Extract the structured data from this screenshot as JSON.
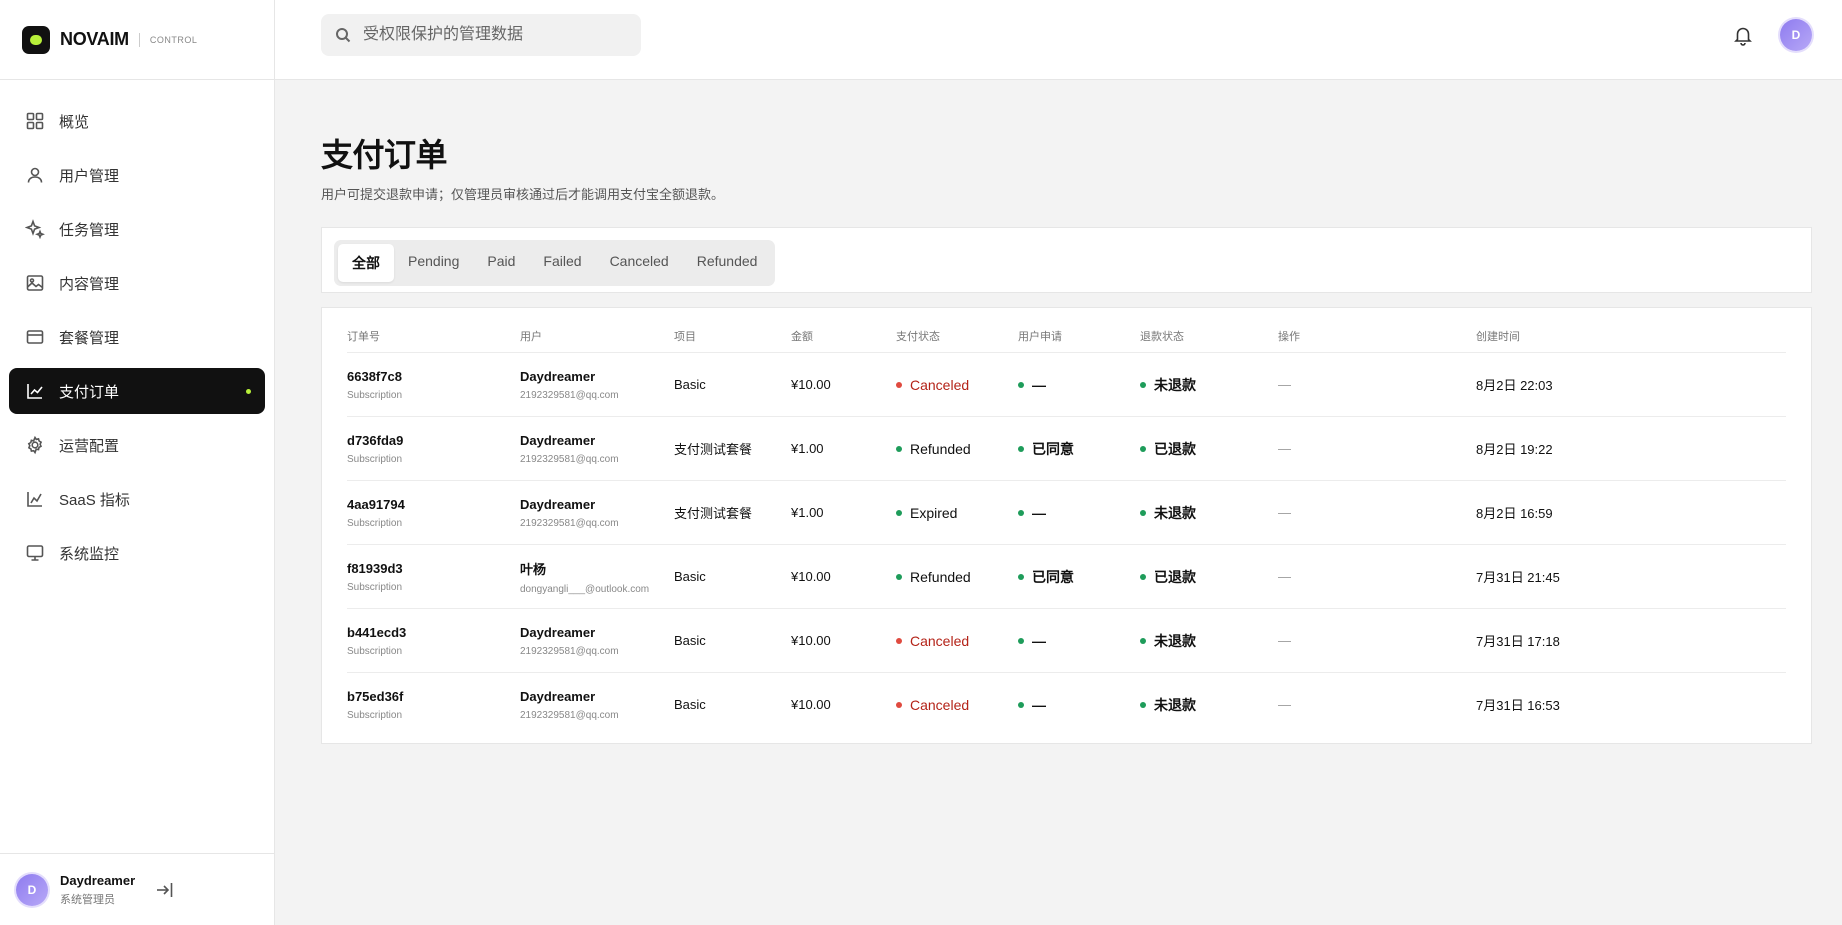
{
  "brand": {
    "name": "NOVAIM",
    "sub": "CONTROL"
  },
  "search": {
    "placeholder": "受权限保护的管理数据"
  },
  "sidebar": {
    "items": [
      {
        "label": "概览",
        "icon": "grid-icon"
      },
      {
        "label": "用户管理",
        "icon": "user-icon"
      },
      {
        "label": "任务管理",
        "icon": "sparkle-icon"
      },
      {
        "label": "内容管理",
        "icon": "image-icon"
      },
      {
        "label": "套餐管理",
        "icon": "card-icon"
      },
      {
        "label": "支付订单",
        "icon": "chart-icon"
      },
      {
        "label": "运营配置",
        "icon": "gear-icon"
      },
      {
        "label": "SaaS 指标",
        "icon": "line-chart-icon"
      },
      {
        "label": "系统监控",
        "icon": "monitor-icon"
      }
    ],
    "active_index": 5,
    "user": {
      "avatar": "D",
      "name": "Daydreamer",
      "role": "系统管理员"
    }
  },
  "topbar": {
    "avatar": "D"
  },
  "page": {
    "title": "支付订单",
    "description": "用户可提交退款申请；仅管理员审核通过后才能调用支付宝全额退款。"
  },
  "tabs": [
    "全部",
    "Pending",
    "Paid",
    "Failed",
    "Canceled",
    "Refunded"
  ],
  "table": {
    "headers": [
      "订单号",
      "用户",
      "项目",
      "金额",
      "支付状态",
      "用户申请",
      "退款状态",
      "操作",
      "创建时间"
    ],
    "rows": [
      {
        "id": "6638f7c8",
        "type": "Subscription",
        "user": "Daydreamer",
        "email": "2192329581@qq.com",
        "item": "Basic",
        "amount": "¥10.00",
        "pay_status": "Canceled",
        "pay_color": "red",
        "apply": "—",
        "refund": "未退款",
        "action": "—",
        "created": "8月2日 22:03"
      },
      {
        "id": "d736fda9",
        "type": "Subscription",
        "user": "Daydreamer",
        "email": "2192329581@qq.com",
        "item": "支付测试套餐",
        "amount": "¥1.00",
        "pay_status": "Refunded",
        "pay_color": "green",
        "apply": "已同意",
        "refund": "已退款",
        "action": "—",
        "created": "8月2日 19:22"
      },
      {
        "id": "4aa91794",
        "type": "Subscription",
        "user": "Daydreamer",
        "email": "2192329581@qq.com",
        "item": "支付测试套餐",
        "amount": "¥1.00",
        "pay_status": "Expired",
        "pay_color": "green",
        "apply": "—",
        "refund": "未退款",
        "action": "—",
        "created": "8月2日 16:59"
      },
      {
        "id": "f81939d3",
        "type": "Subscription",
        "user": "叶杨",
        "email": "dongyangli___@outlook.com",
        "item": "Basic",
        "amount": "¥10.00",
        "pay_status": "Refunded",
        "pay_color": "green",
        "apply": "已同意",
        "refund": "已退款",
        "action": "—",
        "created": "7月31日 21:45"
      },
      {
        "id": "b441ecd3",
        "type": "Subscription",
        "user": "Daydreamer",
        "email": "2192329581@qq.com",
        "item": "Basic",
        "amount": "¥10.00",
        "pay_status": "Canceled",
        "pay_color": "red",
        "apply": "—",
        "refund": "未退款",
        "action": "—",
        "created": "7月31日 17:18"
      },
      {
        "id": "b75ed36f",
        "type": "Subscription",
        "user": "Daydreamer",
        "email": "2192329581@qq.com",
        "item": "Basic",
        "amount": "¥10.00",
        "pay_status": "Canceled",
        "pay_color": "red",
        "apply": "—",
        "refund": "未退款",
        "action": "—",
        "created": "7月31日 16:53"
      }
    ]
  },
  "colors": {
    "accent": "#b8f03a",
    "dark": "#111111",
    "red": "#e04a3f",
    "green": "#1e9c5a"
  }
}
